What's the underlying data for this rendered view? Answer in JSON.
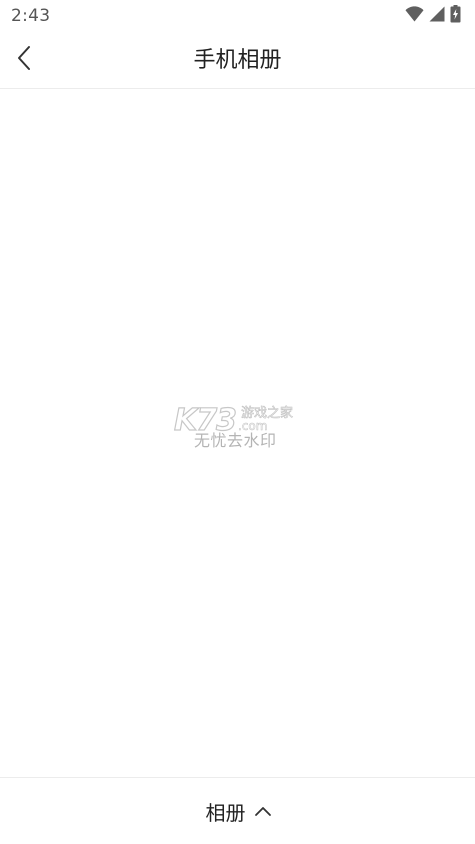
{
  "status_bar": {
    "time": "2:43",
    "icons": [
      "wifi-icon",
      "cellular-signal-icon",
      "battery-charging-icon"
    ]
  },
  "header": {
    "back_icon": "chevron-left-icon",
    "title": "手机相册"
  },
  "watermark": {
    "logo": "K73",
    "site_text": "游戏之家",
    "domain": ".com",
    "caption": "无忧去水印"
  },
  "bottom_bar": {
    "album_label": "相册",
    "expand_icon": "chevron-up-icon"
  },
  "colors": {
    "background": "#ffffff",
    "text_primary": "#222222",
    "status_text": "#555555",
    "divider": "#ececec"
  }
}
